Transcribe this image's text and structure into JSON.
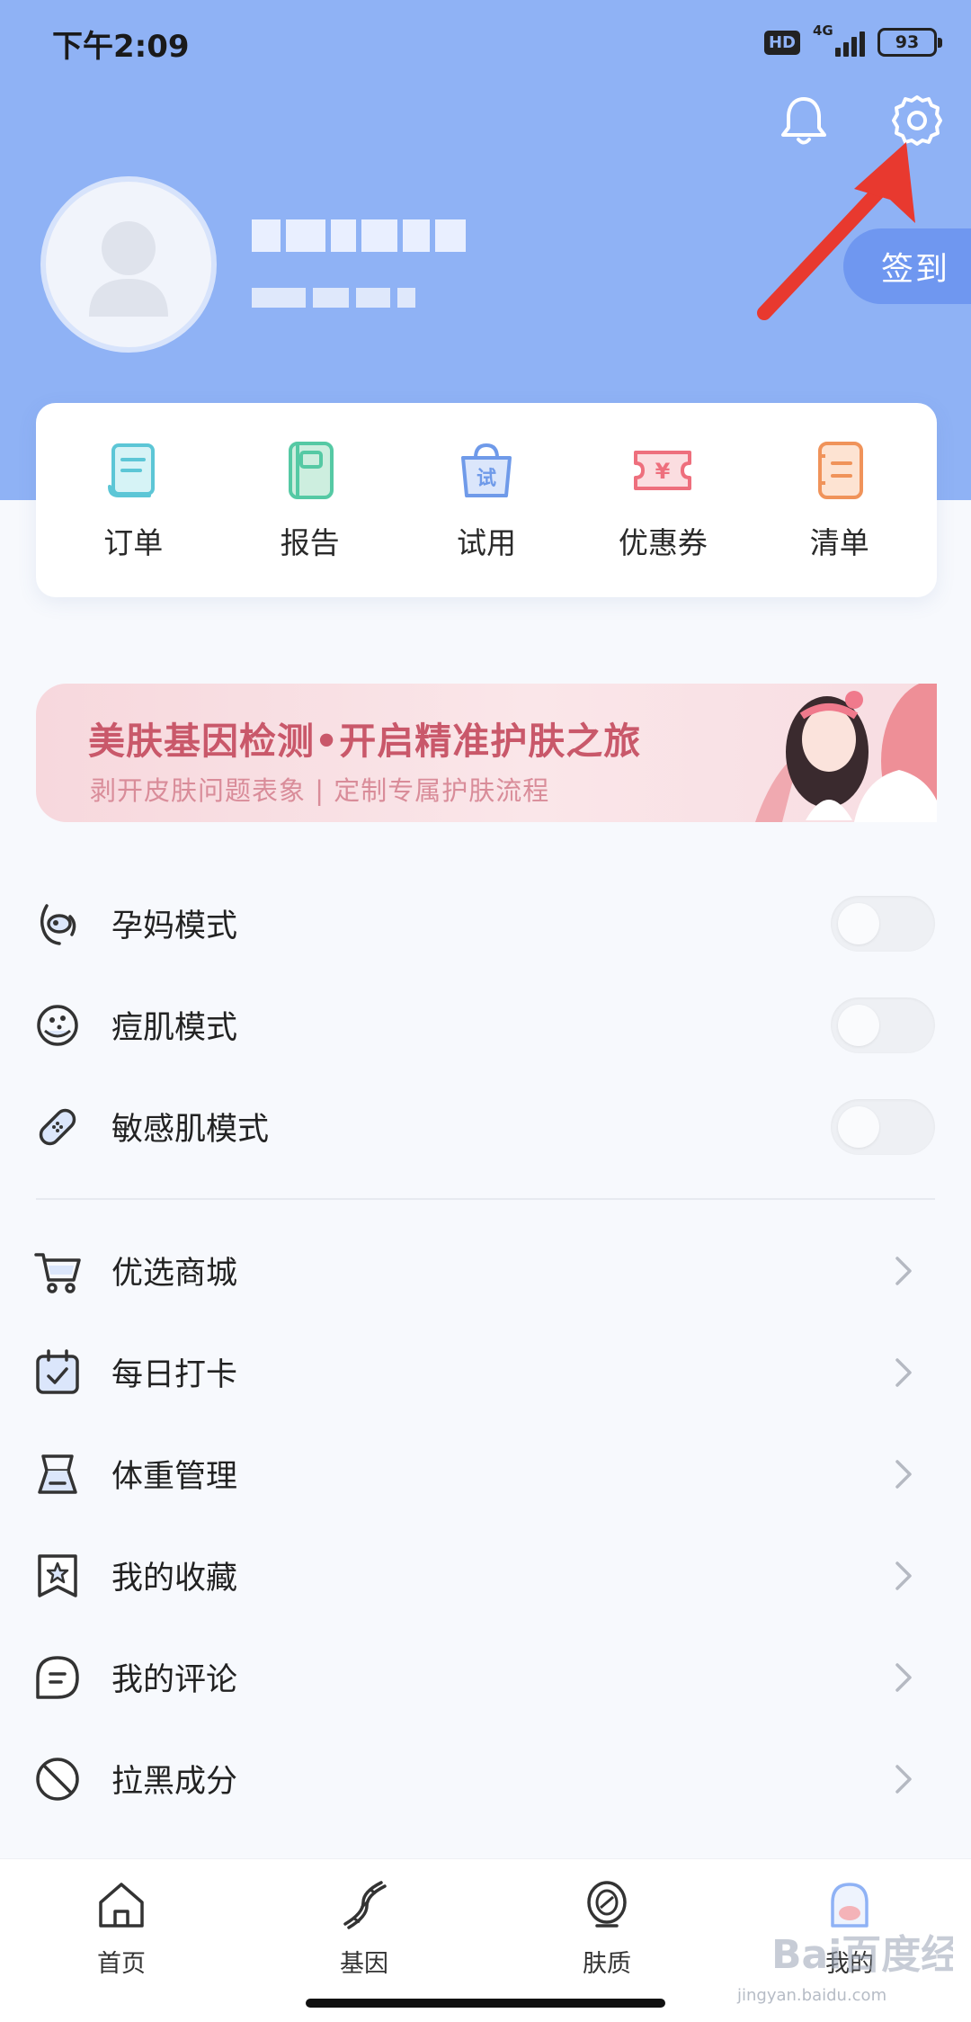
{
  "status_bar": {
    "time": "下午2:09",
    "hd_badge": "HD",
    "network": "4G",
    "battery": "93"
  },
  "header": {
    "checkin_label": "签到",
    "bell_icon": "bell-icon",
    "settings_icon": "gear-icon"
  },
  "quick_actions": [
    {
      "label": "订单",
      "icon": "order-icon",
      "color": "#5cc6d6"
    },
    {
      "label": "报告",
      "icon": "report-icon",
      "color": "#55c9a4"
    },
    {
      "label": "试用",
      "icon": "trial-bag-icon",
      "color": "#6f9ae9",
      "glyph": "试"
    },
    {
      "label": "优惠券",
      "icon": "coupon-icon",
      "color": "#ee6f7d",
      "glyph": "¥"
    },
    {
      "label": "清单",
      "icon": "list-icon",
      "color": "#f0935a"
    }
  ],
  "banner": {
    "title": "美肤基因检测•开启精准护肤之旅",
    "subtitle": "剥开皮肤问题表象 | 定制专属护肤流程"
  },
  "modes": [
    {
      "label": "孕妈模式",
      "icon": "pregnant-icon",
      "enabled": false
    },
    {
      "label": "痘肌模式",
      "icon": "acne-face-icon",
      "enabled": false
    },
    {
      "label": "敏感肌模式",
      "icon": "bandage-icon",
      "enabled": false
    }
  ],
  "menu": [
    {
      "label": "优选商城",
      "icon": "cart-icon"
    },
    {
      "label": "每日打卡",
      "icon": "calendar-check-icon"
    },
    {
      "label": "体重管理",
      "icon": "scale-icon"
    },
    {
      "label": "我的收藏",
      "icon": "bookmark-star-icon"
    },
    {
      "label": "我的评论",
      "icon": "comment-icon"
    },
    {
      "label": "拉黑成分",
      "icon": "block-icon"
    }
  ],
  "tabbar": [
    {
      "label": "首页",
      "icon": "home-icon"
    },
    {
      "label": "基因",
      "icon": "dna-icon"
    },
    {
      "label": "肤质",
      "icon": "skin-icon"
    },
    {
      "label": "我的",
      "icon": "profile-icon"
    }
  ],
  "watermark": {
    "brand": "Bai百度经验",
    "url": "jingyan.baidu.com"
  },
  "colors": {
    "header_bg": "#8fb2f5",
    "checkin_bg": "#6f97f0",
    "banner_accent": "#c9586a",
    "annotation_arrow": "#e8392f"
  }
}
